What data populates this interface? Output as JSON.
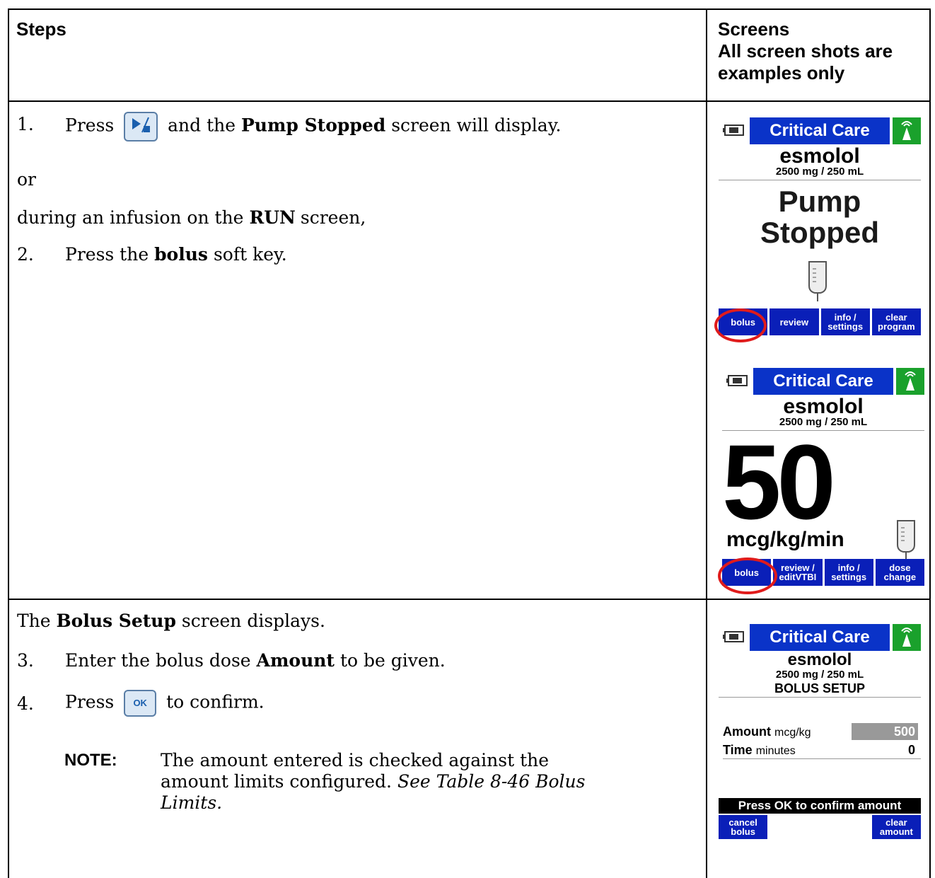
{
  "header": {
    "steps": "Steps",
    "screens_line1": "Screens",
    "screens_line2": "All screen shots are",
    "screens_line3": "examples only"
  },
  "row1": {
    "step1_num": "1.",
    "step1_a": "Press",
    "step1_b": "and the",
    "step1_bold": "Pump Stopped",
    "step1_c": "screen will display.",
    "or": "or",
    "during_a": "during an infusion on the",
    "during_bold": "RUN",
    "during_b": "screen,",
    "step2_num": "2.",
    "step2_a": "Press the",
    "step2_bold": "bolus",
    "step2_b": "soft key."
  },
  "row2": {
    "intro_a": "The",
    "intro_bold": "Bolus Setup",
    "intro_b": "screen displays.",
    "step3_num": "3.",
    "step3_a": "Enter the bolus dose",
    "step3_bold": "Amount",
    "step3_b": "to be given.",
    "step4_num": "4.",
    "step4_a": "Press",
    "step4_key": "OK",
    "step4_b": "to confirm.",
    "note_label": "NOTE:",
    "note_text": "The amount entered is checked against the amount limits configured.",
    "note_italic": "See Table 8-46 Bolus Limits."
  },
  "screen1": {
    "title": "Critical Care",
    "drug": "esmolol",
    "conc": "2500 mg / 250 mL",
    "status_line1": "Pump",
    "status_line2": "Stopped",
    "keys": [
      "bolus",
      "review",
      "info /\nsettings",
      "clear\nprogram"
    ]
  },
  "screen2": {
    "title": "Critical Care",
    "drug": "esmolol",
    "conc": "2500 mg / 250 mL",
    "rate": "50",
    "units": "mcg/kg/min",
    "keys": [
      "bolus",
      "review /\neditVTBI",
      "info /\nsettings",
      "dose\nchange"
    ]
  },
  "screen3": {
    "title": "Critical Care",
    "drug": "esmolol",
    "conc": "2500 mg / 250 mL",
    "heading": "BOLUS SETUP",
    "amount_label": "Amount",
    "amount_unit": "mcg/kg",
    "amount_value": "500",
    "time_label": "Time",
    "time_unit": "minutes",
    "time_value": "0",
    "prompt": "Press OK to confirm amount",
    "keys": [
      "cancel\nbolus",
      "",
      "",
      "clear\namount"
    ]
  }
}
